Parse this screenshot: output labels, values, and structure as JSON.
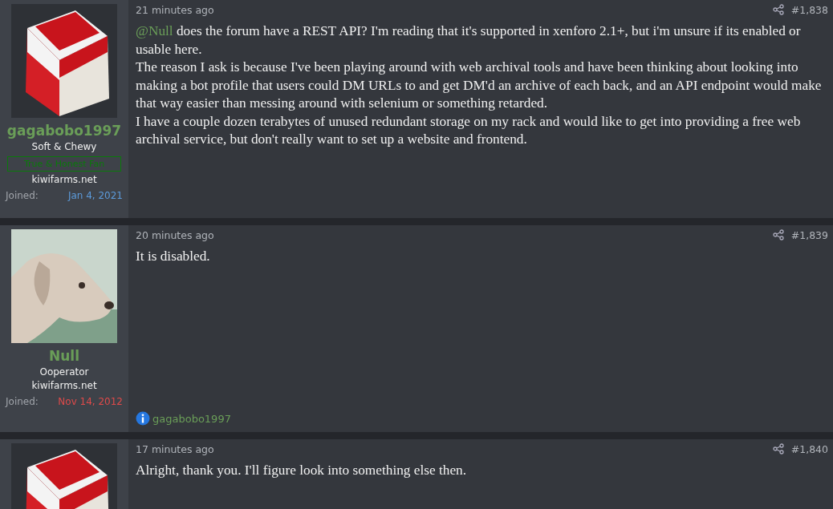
{
  "posts": [
    {
      "user": {
        "name": "gagabobo1997",
        "title": "Soft & Chewy",
        "banner": "True & Honest Fan",
        "site": "kiwifarms.net",
        "joined_label": "Joined:",
        "joined": "Jan 4, 2021",
        "color": "#5c9bdb",
        "avatar": {
          "kind": "cigarettes"
        }
      },
      "time": "21 minutes ago",
      "number": "#1,838",
      "body": [
        [
          {
            "kind": "mention",
            "text": "@Null"
          },
          {
            "kind": "text",
            "text": " does the forum have a REST API? I'm reading that it's supported in xenforo 2.1+, but i'm unsure if its enabled or usable here."
          }
        ],
        [
          {
            "kind": "text",
            "text": "The reason I ask is because I've been playing around with web archival tools and have been thinking about looking into making a bot profile that users could DM URLs to and get DM'd an archive of each back, and an API endpoint would make that way easier than messing around with selenium or something retarded."
          }
        ],
        [
          {
            "kind": "text",
            "text": "I have a couple dozen terabytes of unused redundant storage on my rack and would like to get into providing a free web archival service, but don't really want to set up a website and frontend."
          }
        ]
      ]
    },
    {
      "user": {
        "name": "Null",
        "title": "Ooperator",
        "site": "kiwifarms.net",
        "joined_label": "Joined:",
        "joined": "Nov 14, 2012",
        "color": "#e04a4a",
        "avatar": {
          "kind": "dog"
        }
      },
      "time": "20 minutes ago",
      "number": "#1,839",
      "body": [
        [
          {
            "kind": "text",
            "text": "It is disabled."
          }
        ]
      ],
      "reactions": "gagabobo1997"
    },
    {
      "user": {
        "avatar": {
          "kind": "cigarettes"
        }
      },
      "time": "17 minutes ago",
      "number": "#1,840",
      "body": [
        [
          {
            "kind": "text",
            "text": "Alright, thank you. I'll figure look into something else then."
          }
        ]
      ]
    }
  ]
}
